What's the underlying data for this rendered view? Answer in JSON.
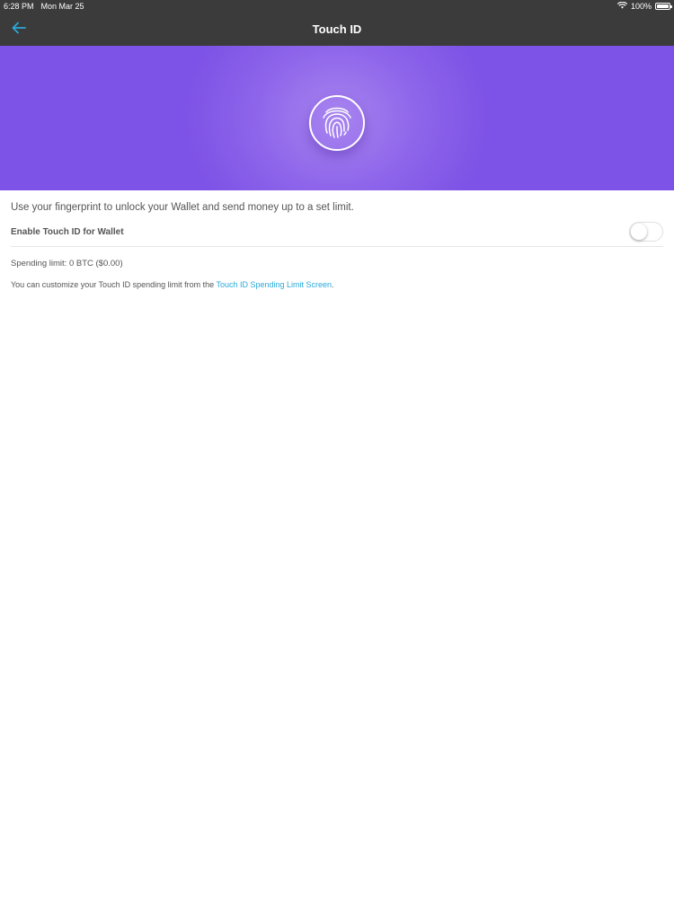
{
  "status_bar": {
    "time": "6:28 PM",
    "date": "Mon Mar 25",
    "battery": "100%"
  },
  "nav": {
    "title": "Touch ID",
    "back_icon": "arrow-left-icon"
  },
  "hero": {
    "icon": "fingerprint-icon",
    "background": "#7d52e6"
  },
  "content": {
    "intro": "Use your fingerprint to unlock your Wallet and send money up to a set limit.",
    "toggle_label": "Enable Touch ID for Wallet",
    "toggle_enabled": false,
    "spending_limit": "Spending limit: 0 BTC ($0.00)",
    "customize_prefix": "You can customize your Touch ID spending limit from the ",
    "customize_link": "Touch ID Spending Limit Screen",
    "customize_suffix": "."
  },
  "colors": {
    "nav_bg": "#3b3b3b",
    "accent_link": "#2aa8d8",
    "back_arrow": "#2aa8d8"
  }
}
